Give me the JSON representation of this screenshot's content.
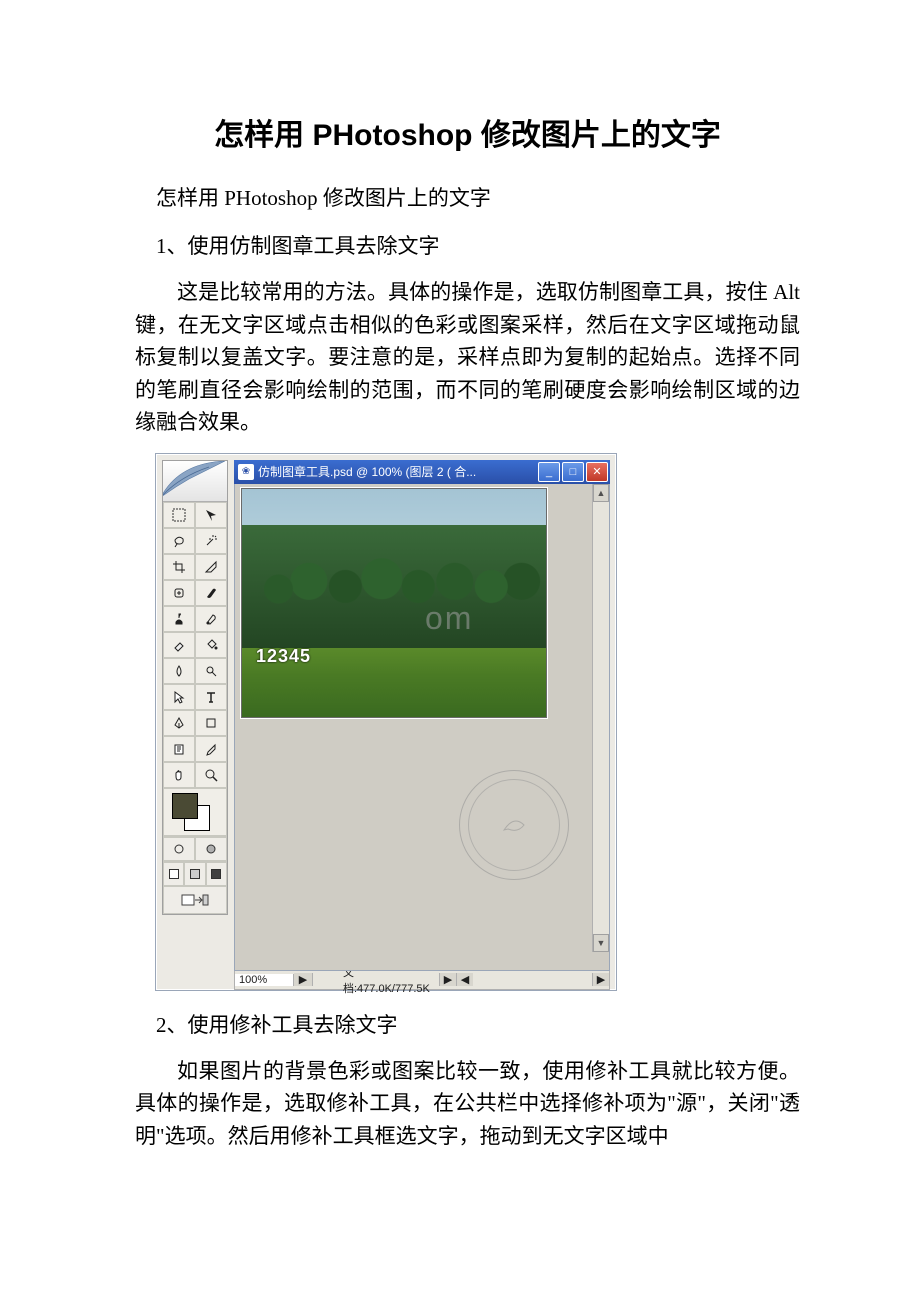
{
  "title": "怎样用 PHotoshop 修改图片上的文字",
  "subtitle": "怎样用 PHotoshop 修改图片上的文字",
  "section1": {
    "heading": "1、使用仿制图章工具去除文字",
    "para": "这是比较常用的方法。具体的操作是，选取仿制图章工具，按住 Alt 键，在无文字区域点击相似的色彩或图案采样，然后在文字区域拖动鼠标复制以复盖文字。要注意的是，采样点即为复制的起始点。选择不同的笔刷直径会影响绘制的范围，而不同的笔刷硬度会影响绘制区域的边缘融合效果。"
  },
  "section2": {
    "heading": "2、使用修补工具去除文字",
    "para": "如果图片的背景色彩或图案比较一致，使用修补工具就比较方便。具体的操作是，选取修补工具，在公共栏中选择修补项为\"源\"，关闭\"透明\"选项。然后用修补工具框选文字，拖动到无文字区域中"
  },
  "ps": {
    "titlebar": "仿制图章工具.psd @ 100% (图层 2 ( 合...",
    "canvas_text": "12345",
    "zoom": "100%",
    "docinfo": "文档:477.0K/777.5K",
    "watermark_fragment": "om"
  }
}
